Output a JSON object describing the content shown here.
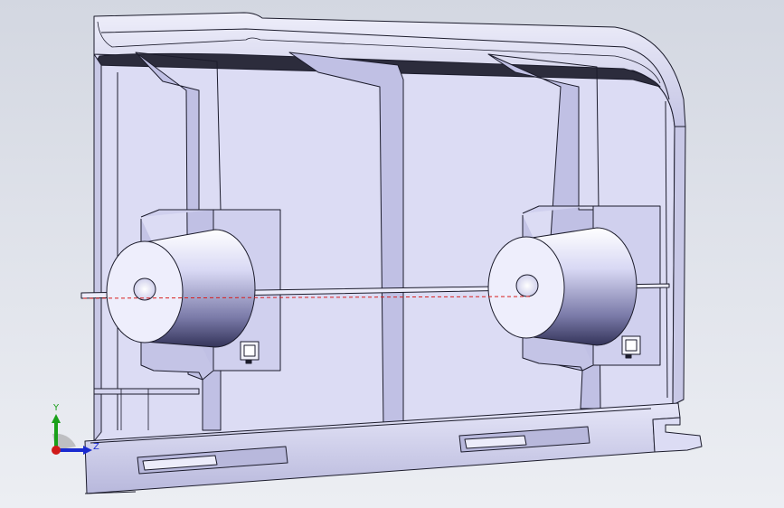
{
  "viewport": {
    "background_top": "#d3d7e1",
    "background_bottom": "#eceef3"
  },
  "model": {
    "face_color": "#dcdcf4",
    "face_dark": "#b4b4e0",
    "edge_color": "#1c1c2c",
    "cylinder_light": "#f6f6ff",
    "cylinder_dark": "#3c3c64",
    "section_line_color": "#d81e1e"
  },
  "triad": {
    "y_label": "Y",
    "z_label": "Z",
    "y_color": "#1aa01a",
    "z_color": "#1a2ad0",
    "x_color": "#d01a1a"
  }
}
